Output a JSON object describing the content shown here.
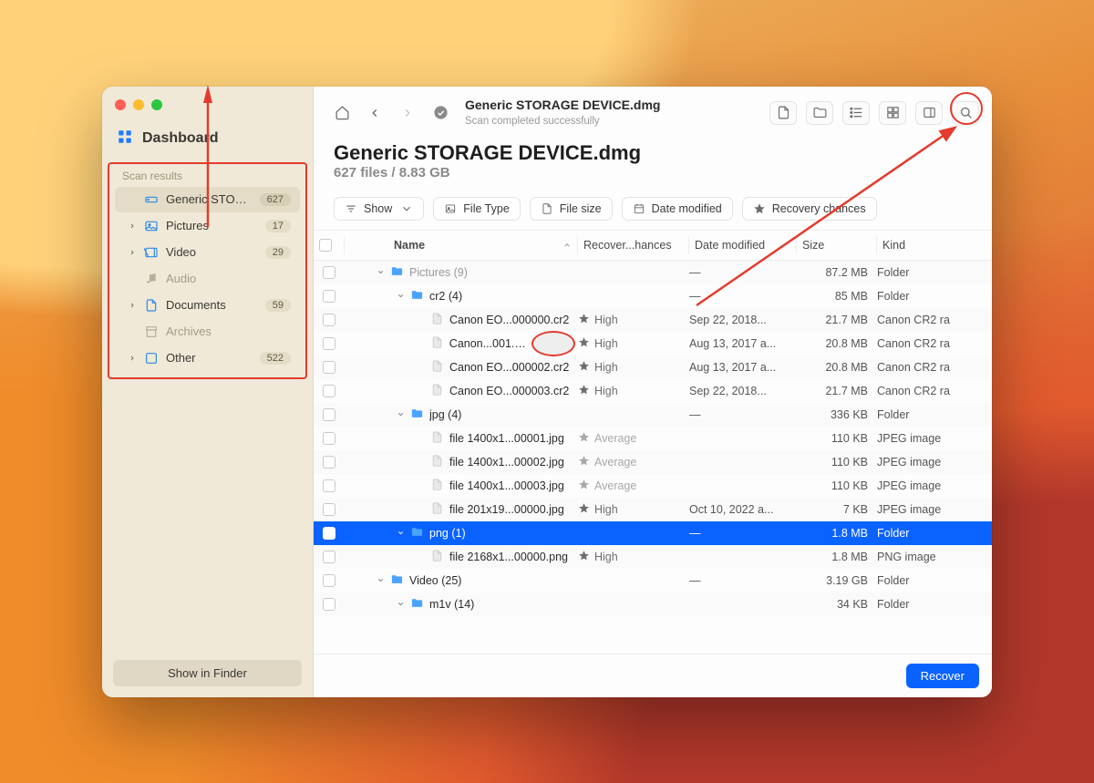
{
  "sidebar": {
    "dashboard_label": "Dashboard",
    "section_label": "Scan results",
    "items": [
      {
        "label": "Generic STORAG...",
        "count": "627",
        "icon": "drive",
        "expandable": false,
        "active": true
      },
      {
        "label": "Pictures",
        "count": "17",
        "icon": "image",
        "expandable": true
      },
      {
        "label": "Video",
        "count": "29",
        "icon": "video",
        "expandable": true
      },
      {
        "label": "Audio",
        "count": "",
        "icon": "audio",
        "expandable": false,
        "dim": true
      },
      {
        "label": "Documents",
        "count": "59",
        "icon": "doc",
        "expandable": true
      },
      {
        "label": "Archives",
        "count": "",
        "icon": "archive",
        "expandable": false,
        "dim": true
      },
      {
        "label": "Other",
        "count": "522",
        "icon": "other",
        "expandable": true
      }
    ],
    "footer_button": "Show in Finder"
  },
  "toolbar": {
    "title": "Generic STORAGE DEVICE.dmg",
    "subtitle": "Scan completed successfully"
  },
  "header": {
    "title": "Generic STORAGE DEVICE.dmg",
    "subtitle": "627 files / 8.83 GB"
  },
  "filters": {
    "show": "Show",
    "file_type": "File Type",
    "file_size": "File size",
    "date_modified": "Date modified",
    "recovery_chances": "Recovery chances"
  },
  "columns": {
    "name": "Name",
    "recovery": "Recover...hances",
    "date": "Date modified",
    "size": "Size",
    "kind": "Kind"
  },
  "rows": [
    {
      "indent": 1,
      "type": "folder",
      "open": true,
      "name": "Pictures (9)",
      "rec": "",
      "date": "—",
      "size": "87.2 MB",
      "kind": "Folder",
      "faded": true
    },
    {
      "indent": 2,
      "type": "folder",
      "open": true,
      "name": "cr2 (4)",
      "rec": "",
      "date": "—",
      "size": "85 MB",
      "kind": "Folder"
    },
    {
      "indent": 3,
      "type": "file",
      "name": "Canon EO...000000.cr2",
      "rec": "High",
      "date": "Sep 22, 2018...",
      "size": "21.7 MB",
      "kind": "Canon CR2 ra"
    },
    {
      "indent": 3,
      "type": "file",
      "eye": true,
      "name": "Canon...001.cr2",
      "rec": "High",
      "date": "Aug 13, 2017 a...",
      "size": "20.8 MB",
      "kind": "Canon CR2 ra"
    },
    {
      "indent": 3,
      "type": "file",
      "name": "Canon EO...000002.cr2",
      "rec": "High",
      "date": "Aug 13, 2017 a...",
      "size": "20.8 MB",
      "kind": "Canon CR2 ra"
    },
    {
      "indent": 3,
      "type": "file",
      "name": "Canon EO...000003.cr2",
      "rec": "High",
      "date": "Sep 22, 2018...",
      "size": "21.7 MB",
      "kind": "Canon CR2 ra"
    },
    {
      "indent": 2,
      "type": "folder",
      "open": true,
      "name": "jpg (4)",
      "rec": "",
      "date": "—",
      "size": "336 KB",
      "kind": "Folder"
    },
    {
      "indent": 3,
      "type": "file",
      "name": "file 1400x1...00001.jpg",
      "rec": "Average",
      "date": "",
      "size": "110 KB",
      "kind": "JPEG image"
    },
    {
      "indent": 3,
      "type": "file",
      "name": "file 1400x1...00002.jpg",
      "rec": "Average",
      "date": "",
      "size": "110 KB",
      "kind": "JPEG image"
    },
    {
      "indent": 3,
      "type": "file",
      "name": "file 1400x1...00003.jpg",
      "rec": "Average",
      "date": "",
      "size": "110 KB",
      "kind": "JPEG image"
    },
    {
      "indent": 3,
      "type": "file",
      "name": "file 201x19...00000.jpg",
      "rec": "High",
      "date": "Oct 10, 2022 a...",
      "size": "7 KB",
      "kind": "JPEG image"
    },
    {
      "indent": 2,
      "type": "folder",
      "open": true,
      "name": "png (1)",
      "rec": "",
      "date": "—",
      "size": "1.8 MB",
      "kind": "Folder",
      "selected": true
    },
    {
      "indent": 3,
      "type": "file",
      "name": "file 2168x1...00000.png",
      "rec": "High",
      "date": "",
      "size": "1.8 MB",
      "kind": "PNG image"
    },
    {
      "indent": 1,
      "type": "folder",
      "open": true,
      "name": "Video (25)",
      "rec": "",
      "date": "—",
      "size": "3.19 GB",
      "kind": "Folder"
    },
    {
      "indent": 2,
      "type": "folder",
      "open": true,
      "name": "m1v (14)",
      "rec": "",
      "date": "",
      "size": "34 KB",
      "kind": "Folder"
    }
  ],
  "footer": {
    "recover": "Recover"
  }
}
